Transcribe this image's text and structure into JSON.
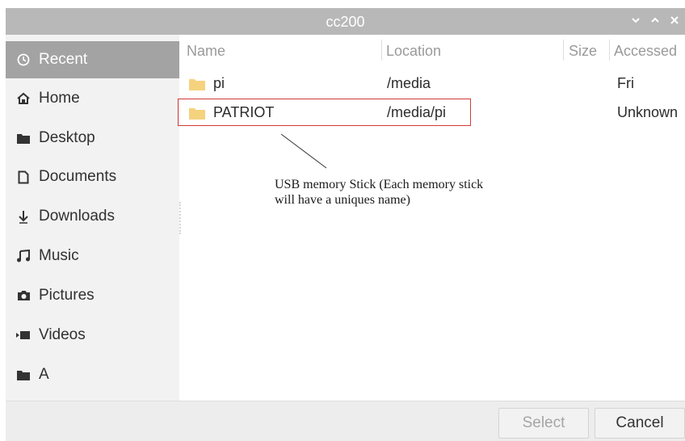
{
  "window": {
    "title": "cc200",
    "controls": [
      "minimize-icon",
      "maximize-icon",
      "close-icon"
    ]
  },
  "sidebar": {
    "items": [
      {
        "label": "Recent",
        "icon": "clock-icon",
        "active": true
      },
      {
        "label": "Home",
        "icon": "home-icon",
        "active": false
      },
      {
        "label": "Desktop",
        "icon": "folder-icon",
        "active": false
      },
      {
        "label": "Documents",
        "icon": "document-icon",
        "active": false
      },
      {
        "label": "Downloads",
        "icon": "download-icon",
        "active": false
      },
      {
        "label": "Music",
        "icon": "music-icon",
        "active": false
      },
      {
        "label": "Pictures",
        "icon": "camera-icon",
        "active": false
      },
      {
        "label": "Videos",
        "icon": "video-icon",
        "active": false
      },
      {
        "label": "A",
        "icon": "folder-icon",
        "active": false
      }
    ]
  },
  "table": {
    "columns": [
      "Name",
      "Location",
      "Size",
      "Accessed"
    ],
    "rows": [
      {
        "name": "pi",
        "location": "/media",
        "size": "",
        "accessed": "Fri"
      },
      {
        "name": "PATRIOT",
        "location": "/media/pi",
        "size": "",
        "accessed": "Unknown"
      }
    ]
  },
  "annotation": {
    "line1": "USB memory Stick (Each memory stick",
    "line2": "will have a uniques name)"
  },
  "footer": {
    "select_label": "Select",
    "cancel_label": "Cancel"
  },
  "colors": {
    "titlebar": "#b8b8b8",
    "active_sidebar": "#a3a3a3",
    "folder": "#f5d27e",
    "highlight_border": "#d43a3a"
  }
}
